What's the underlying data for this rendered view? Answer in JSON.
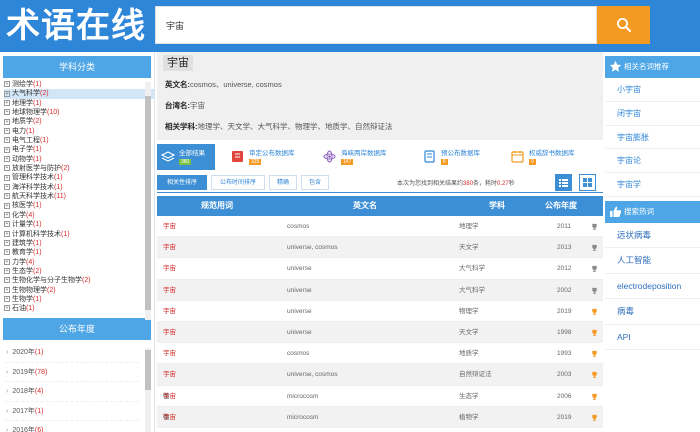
{
  "header": {
    "logo": "术语在线",
    "search_value": "宇宙"
  },
  "colors": {
    "primary": "#2e86d8",
    "accent": "#f39a23",
    "count_red": "#d62a2a"
  },
  "left": {
    "category_title": "学科分类",
    "categories": [
      {
        "name": "测绘学",
        "count": "(1)"
      },
      {
        "name": "大气科学",
        "count": "(2)",
        "selected": true
      },
      {
        "name": "地理学",
        "count": "(1)"
      },
      {
        "name": "地球物理学",
        "count": "(10)"
      },
      {
        "name": "地质学",
        "count": "(2)"
      },
      {
        "name": "电力",
        "count": "(1)"
      },
      {
        "name": "电气工程",
        "count": "(1)"
      },
      {
        "name": "电子学",
        "count": "(1)"
      },
      {
        "name": "动物学",
        "count": "(1)"
      },
      {
        "name": "放射医学与防护",
        "count": "(2)"
      },
      {
        "name": "管理科学技术",
        "count": "(1)"
      },
      {
        "name": "海洋科学技术",
        "count": "(1)"
      },
      {
        "name": "航天科学技术",
        "count": "(11)"
      },
      {
        "name": "核医学",
        "count": "(1)"
      },
      {
        "name": "化学",
        "count": "(4)"
      },
      {
        "name": "计量学",
        "count": "(1)"
      },
      {
        "name": "计算机科学技术",
        "count": "(1)"
      },
      {
        "name": "建筑学",
        "count": "(1)"
      },
      {
        "name": "教育学",
        "count": "(1)"
      },
      {
        "name": "力学",
        "count": "(4)"
      },
      {
        "name": "生态学",
        "count": "(2)"
      },
      {
        "name": "生物化学与分子生物学",
        "count": "(2)"
      },
      {
        "name": "生物物理学",
        "count": "(2)"
      },
      {
        "name": "生物学",
        "count": "(1)"
      },
      {
        "name": "石油",
        "count": "(1)"
      }
    ],
    "year_title": "公布年度",
    "years": [
      {
        "year": "2020年",
        "count": "(1)"
      },
      {
        "year": "2019年",
        "count": "(78)"
      },
      {
        "year": "2018年",
        "count": "(4)"
      },
      {
        "year": "2017年",
        "count": "(1)"
      },
      {
        "year": "2016年",
        "count": "(6)"
      }
    ]
  },
  "term": {
    "title": "宇宙",
    "en_label": "英文名:",
    "en_value": "cosmos、universe, cosmos",
    "tw_label": "台湾名:",
    "tw_value": "宇宙",
    "subj_label": "相关学科:",
    "subj_value": "地理学、天文学、大气科学、物理学、地质学、自然辩证法"
  },
  "tabs": [
    {
      "label": "全部结果",
      "badge": "380",
      "active": true
    },
    {
      "label": "审定公布数据库",
      "badge": "325"
    },
    {
      "label": "海峡两岸数据库",
      "badge": "147"
    },
    {
      "label": "预公布数据库",
      "badge": "8"
    },
    {
      "label": "权威辞书数据库",
      "badge": "9"
    }
  ],
  "sort": {
    "buttons": [
      "相关性排序",
      "公布时间排序",
      "精确",
      "包含"
    ],
    "info_pre": "本次为您找到相关结果约",
    "info_count": "380",
    "info_mid": "条，耗时",
    "info_time": "0.27",
    "info_post": "秒"
  },
  "table": {
    "headers": [
      "规范用词",
      "英文名",
      "学科",
      "公布年度"
    ],
    "rows": [
      {
        "pre": "",
        "term": "宇宙",
        "en": "cosmos",
        "subj": "地理学",
        "year": "2011",
        "icon": "gray"
      },
      {
        "pre": "",
        "term": "宇宙",
        "en": "universe, cosmos",
        "subj": "天文学",
        "year": "2013",
        "icon": "gray"
      },
      {
        "pre": "",
        "term": "宇宙",
        "en": "universe",
        "subj": "大气科学",
        "year": "2012",
        "icon": "gray"
      },
      {
        "pre": "",
        "term": "宇宙",
        "en": "universe",
        "subj": "大气科学",
        "year": "2002",
        "icon": "gray"
      },
      {
        "pre": "",
        "term": "宇宙",
        "en": "universe",
        "subj": "物理学",
        "year": "2019",
        "icon": "orange"
      },
      {
        "pre": "",
        "term": "宇宙",
        "en": "universe",
        "subj": "天文学",
        "year": "1998",
        "icon": "orange"
      },
      {
        "pre": "",
        "term": "宇宙",
        "en": "cosmos",
        "subj": "地质学",
        "year": "1993",
        "icon": "orange"
      },
      {
        "pre": "",
        "term": "宇宙",
        "en": "universe, cosmos",
        "subj": "自然辩证法",
        "year": "2003",
        "icon": "orange"
      },
      {
        "pre": "微",
        "term": "宇宙",
        "en": "microcosm",
        "subj": "生态学",
        "year": "2006",
        "icon": "orange"
      },
      {
        "pre": "微",
        "term": "宇宙",
        "en": "microcosm",
        "subj": "植物学",
        "year": "2019",
        "icon": "orange"
      }
    ]
  },
  "right": {
    "related_title": "相关名词推荐",
    "related": [
      "小宇宙",
      "闭宇宙",
      "宇宙膨胀",
      "宇宙论",
      "宇宙学"
    ],
    "hot_title": "搜索热词",
    "hot": [
      "远状病毒",
      "人工智能",
      "electrodeposition",
      "病毒",
      "API"
    ]
  }
}
